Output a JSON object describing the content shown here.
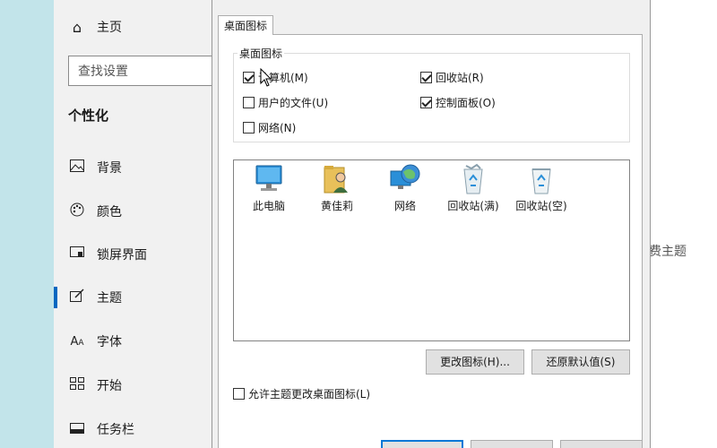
{
  "settings": {
    "home_label": "主页",
    "search_placeholder": "查找设置",
    "section_title": "个性化",
    "nav": [
      {
        "label": "背景",
        "icon": "image-icon"
      },
      {
        "label": "颜色",
        "icon": "palette-icon"
      },
      {
        "label": "锁屏界面",
        "icon": "lock-screen-icon"
      },
      {
        "label": "主题",
        "icon": "theme-brush-icon"
      },
      {
        "label": "字体",
        "icon": "font-icon"
      },
      {
        "label": "开始",
        "icon": "start-grid-icon"
      },
      {
        "label": "任务栏",
        "icon": "taskbar-icon"
      }
    ],
    "right_partial_text": "费主题"
  },
  "dialog": {
    "tab_label": "桌面图标",
    "group_title": "桌面图标",
    "checkboxes": [
      {
        "label": "计算机(M)",
        "checked": true
      },
      {
        "label": "回收站(R)",
        "checked": true
      },
      {
        "label": "用户的文件(U)",
        "checked": false
      },
      {
        "label": "控制面板(O)",
        "checked": true
      },
      {
        "label": "网络(N)",
        "checked": false
      }
    ],
    "icons": [
      {
        "label": "此电脑",
        "icon": "computer-icon"
      },
      {
        "label": "黄佳莉",
        "icon": "user-folder-icon"
      },
      {
        "label": "网络",
        "icon": "network-globe-icon"
      },
      {
        "label": "回收站(满)",
        "icon": "recycle-bin-full-icon"
      },
      {
        "label": "回收站(空)",
        "icon": "recycle-bin-empty-icon"
      }
    ],
    "change_icon_label": "更改图标(H)...",
    "restore_default_label": "还原默认值(S)",
    "allow_themes_label": "允许主题更改桌面图标(L)",
    "allow_themes_checked": false
  }
}
